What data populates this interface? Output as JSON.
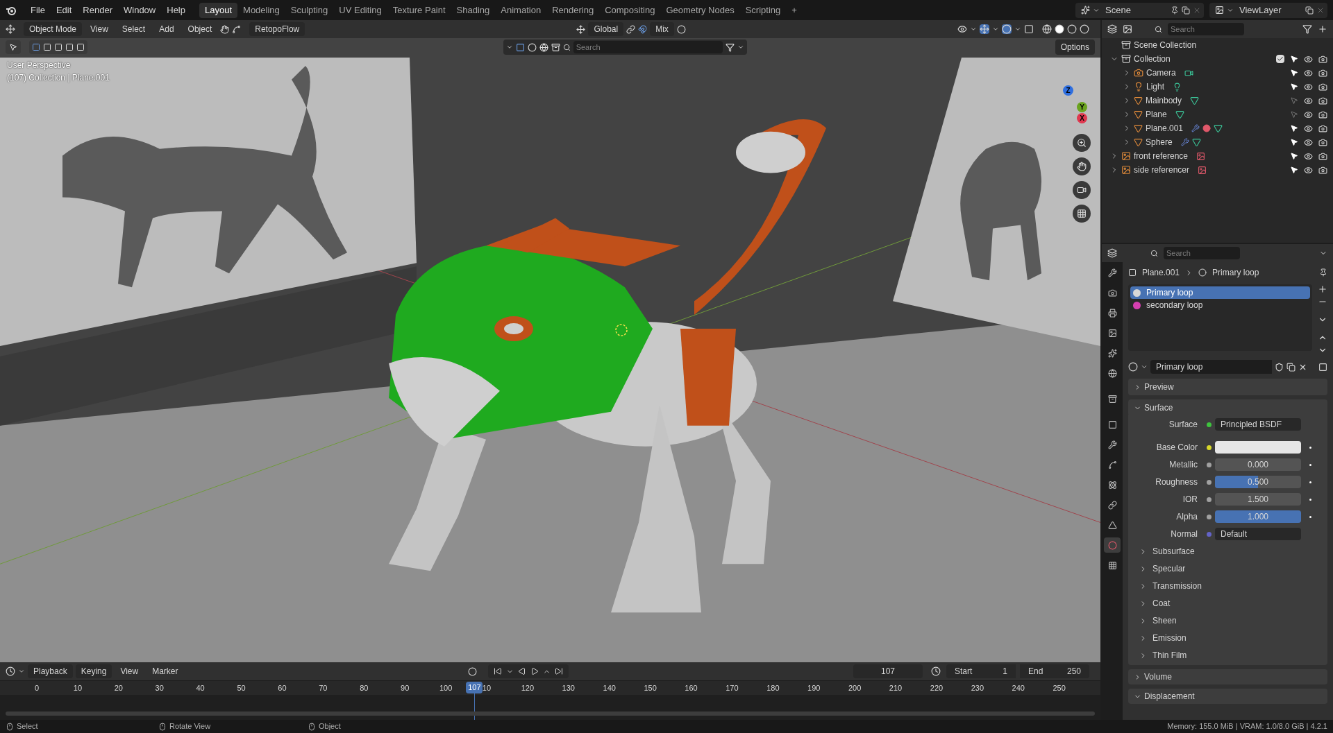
{
  "top_bar": {
    "menus": [
      "File",
      "Edit",
      "Render",
      "Window",
      "Help"
    ],
    "workspaces": [
      {
        "label": "Layout",
        "selected": true
      },
      {
        "label": "Modeling",
        "selected": false
      },
      {
        "label": "Sculpting",
        "selected": false
      },
      {
        "label": "UV Editing",
        "selected": false
      },
      {
        "label": "Texture Paint",
        "selected": false
      },
      {
        "label": "Shading",
        "selected": false
      },
      {
        "label": "Animation",
        "selected": false
      },
      {
        "label": "Rendering",
        "selected": false
      },
      {
        "label": "Compositing",
        "selected": false
      },
      {
        "label": "Geometry Nodes",
        "selected": false
      },
      {
        "label": "Scripting",
        "selected": false
      }
    ],
    "add_tab": "+",
    "scene": "Scene",
    "view_layer": "ViewLayer"
  },
  "viewport": {
    "mode": "Object Mode",
    "menus": [
      "View",
      "Select",
      "Add",
      "Object"
    ],
    "addon": "RetopoFlow",
    "orientation": "Global",
    "snap": "Mix",
    "search_placeholder": "Search",
    "options": "Options",
    "info_lines": [
      "User Perspective",
      "(107) Collection | Plane.001"
    ],
    "gizmo_axes": [
      {
        "label": "Z",
        "color": "#2f6fe0"
      },
      {
        "label": "Y",
        "color": "#6aa31f"
      },
      {
        "label": "X",
        "color": "#e0384f"
      }
    ]
  },
  "outliner": {
    "search_placeholder": "Search",
    "root": "Scene Collection",
    "tree": [
      {
        "name": "Collection",
        "kind": "collection",
        "expanded": true,
        "checked": true,
        "selectable": true,
        "children": [
          {
            "name": "Camera",
            "kind": "camera",
            "expanded": false,
            "selectable": true,
            "has_modifier": false,
            "has_material": false
          },
          {
            "name": "Light",
            "kind": "light",
            "expanded": false,
            "selectable": true,
            "has_modifier": false,
            "has_material": false
          },
          {
            "name": "Mainbody",
            "kind": "mesh",
            "expanded": false,
            "selectable": false,
            "has_modifier": false,
            "has_material": false
          },
          {
            "name": "Plane",
            "kind": "mesh",
            "expanded": false,
            "selectable": false,
            "has_modifier": false,
            "has_material": false
          },
          {
            "name": "Plane.001",
            "kind": "mesh",
            "expanded": false,
            "selectable": true,
            "has_modifier": true,
            "has_material": true
          },
          {
            "name": "Sphere",
            "kind": "mesh",
            "expanded": false,
            "selectable": true,
            "has_modifier": true,
            "has_material": false
          }
        ]
      },
      {
        "name": "front reference",
        "kind": "image",
        "expanded": false,
        "selectable": true
      },
      {
        "name": "side referencer",
        "kind": "image",
        "expanded": false,
        "selectable": true
      }
    ]
  },
  "properties": {
    "search_placeholder": "Search",
    "tabs": [
      {
        "kind": "tool",
        "selected": false
      },
      {
        "kind": "render",
        "selected": false
      },
      {
        "kind": "output",
        "selected": false
      },
      {
        "kind": "view_layer",
        "selected": false
      },
      {
        "kind": "scene",
        "selected": false
      },
      {
        "kind": "world",
        "selected": false
      },
      {
        "kind": "collection",
        "selected": false
      },
      {
        "kind": "object",
        "selected": false
      },
      {
        "kind": "modifiers",
        "selected": false
      },
      {
        "kind": "particles",
        "selected": false
      },
      {
        "kind": "physics",
        "selected": false
      },
      {
        "kind": "constraints",
        "selected": false
      },
      {
        "kind": "data",
        "selected": false
      },
      {
        "kind": "material",
        "selected": true
      },
      {
        "kind": "texture",
        "selected": false
      }
    ],
    "breadcrumb": [
      "Plane.001",
      "Primary loop"
    ],
    "slots": [
      {
        "name": "Primary loop",
        "selected": true,
        "color": "#d8d8d8"
      },
      {
        "name": "secondary loop",
        "selected": false,
        "color": "#d63fb0"
      }
    ],
    "material_name": "Primary loop",
    "panels": [
      {
        "title": "Preview",
        "expanded": false
      },
      {
        "title": "Surface",
        "expanded": true
      }
    ],
    "fields": [
      {
        "label": "Surface",
        "kind": "link",
        "value": "Principled BSDF",
        "color": "#3ec43e"
      },
      {
        "label": "Base Color",
        "kind": "color",
        "color": "#d8d82a"
      },
      {
        "label": "Metallic",
        "kind": "number",
        "value": "0.000",
        "level": 0,
        "color": "#a1a1a1"
      },
      {
        "label": "Roughness",
        "kind": "number",
        "value": "0.500",
        "level": 0.5,
        "color": "#a1a1a1"
      },
      {
        "label": "IOR",
        "kind": "number",
        "value": "1.500",
        "level": 0,
        "color": "#a1a1a1"
      },
      {
        "label": "Alpha",
        "kind": "number",
        "value": "1.000",
        "level": 1,
        "color": "#a1a1a1"
      },
      {
        "label": "Normal",
        "kind": "link",
        "value": "Default",
        "color": "#6363c7"
      }
    ],
    "subpanels": [
      {
        "title": "Subsurface",
        "expanded": false
      },
      {
        "title": "Specular",
        "expanded": false
      },
      {
        "title": "Transmission",
        "expanded": false
      },
      {
        "title": "Coat",
        "expanded": false
      },
      {
        "title": "Sheen",
        "expanded": false
      },
      {
        "title": "Emission",
        "expanded": false
      },
      {
        "title": "Thin Film",
        "expanded": false
      }
    ],
    "bottom_panels": [
      {
        "title": "Volume",
        "expanded": false
      },
      {
        "title": "Displacement",
        "expanded": true
      }
    ]
  },
  "timeline": {
    "menus": [
      "Playback",
      "Keying",
      "View",
      "Marker"
    ],
    "current_frame": "107",
    "start_label": "Start",
    "start": "1",
    "end_label": "End",
    "end": "250",
    "ticks": [
      "0",
      "10",
      "20",
      "30",
      "40",
      "50",
      "60",
      "70",
      "80",
      "90",
      "100",
      "10",
      "120",
      "130",
      "140",
      "150",
      "160",
      "170",
      "180",
      "190",
      "200",
      "210",
      "220",
      "230",
      "240",
      "250"
    ],
    "playhead": {
      "label": "107",
      "level": 0.428
    }
  },
  "status_bar": {
    "hints": [
      {
        "label": "Select"
      },
      {
        "label": "Rotate View"
      },
      {
        "label": "Object"
      }
    ],
    "stats": "Memory: 155.0 MiB | VRAM: 1.0/8.0 GiB | 4.2.1"
  }
}
